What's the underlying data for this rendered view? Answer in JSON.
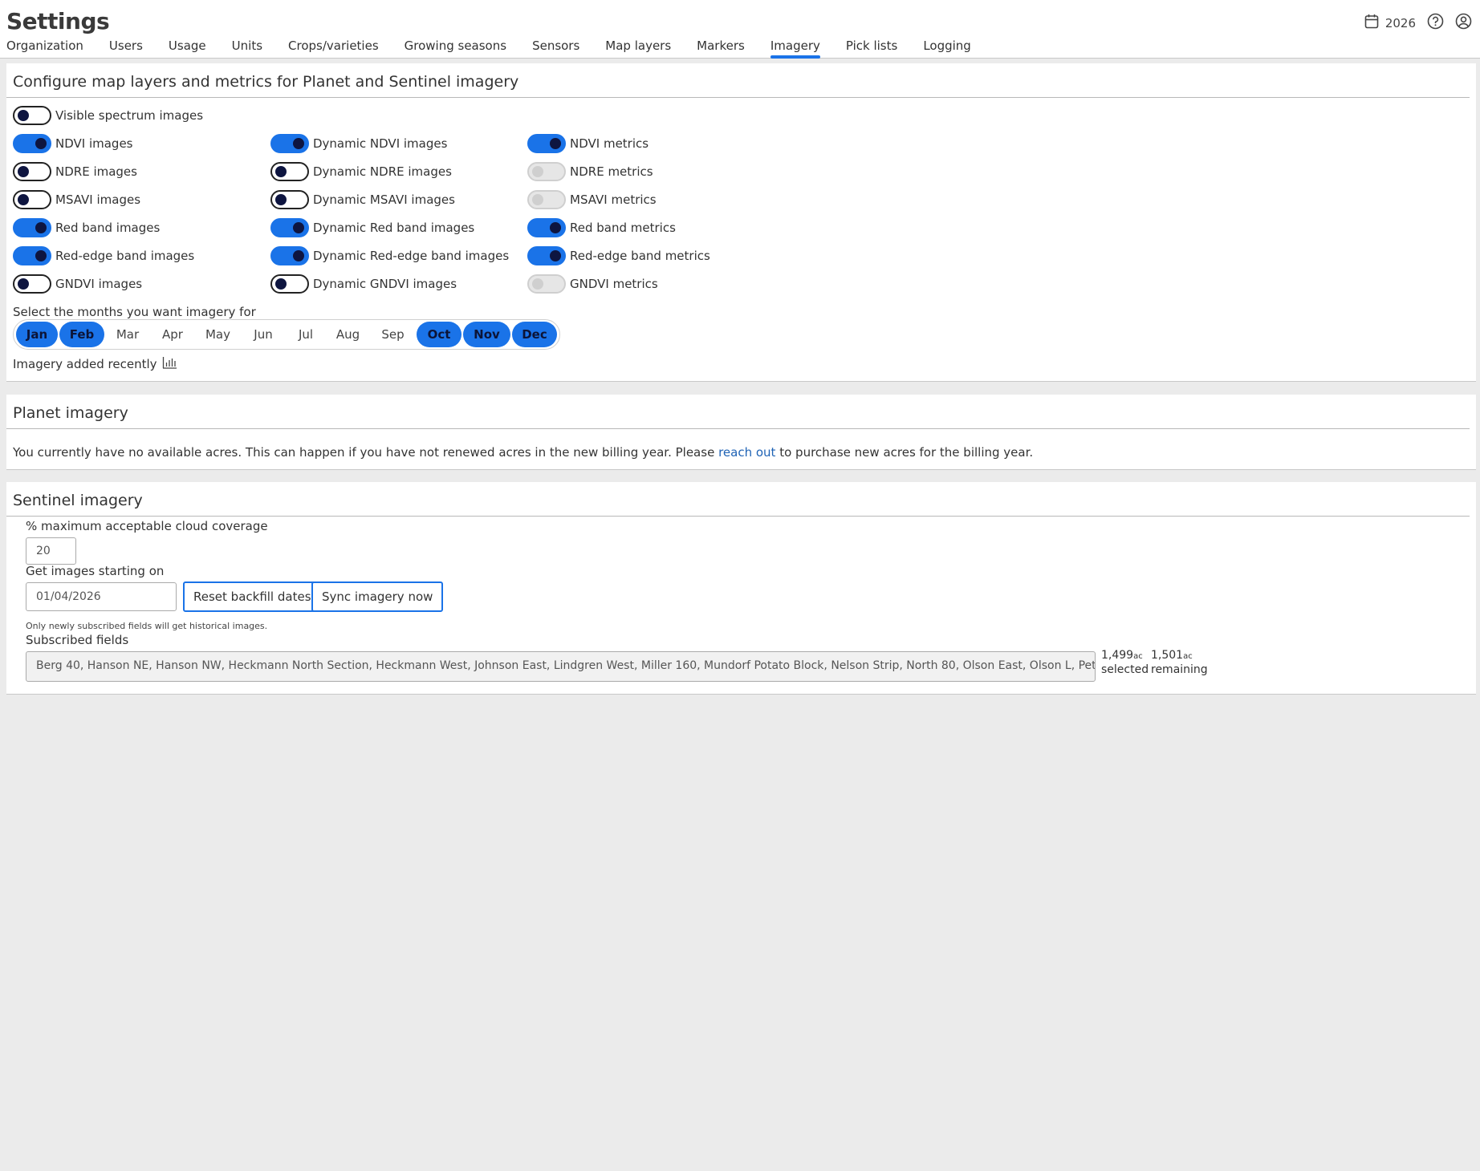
{
  "header": {
    "title": "Settings",
    "year": "2026",
    "tabs": [
      {
        "label": "Organization"
      },
      {
        "label": "Users"
      },
      {
        "label": "Usage"
      },
      {
        "label": "Units"
      },
      {
        "label": "Crops/varieties"
      },
      {
        "label": "Growing seasons"
      },
      {
        "label": "Sensors"
      },
      {
        "label": "Map layers"
      },
      {
        "label": "Markers"
      },
      {
        "label": "Imagery",
        "active": true
      },
      {
        "label": "Pick lists"
      },
      {
        "label": "Logging"
      }
    ]
  },
  "config": {
    "title": "Configure map layers and metrics for Planet and Sentinel imagery",
    "toggles": [
      {
        "label": "Visible spectrum images",
        "state": "off"
      },
      {
        "label": "NDVI images",
        "state": "on"
      },
      {
        "label": "Dynamic NDVI images",
        "state": "on"
      },
      {
        "label": "NDVI metrics",
        "state": "on"
      },
      {
        "label": "NDRE images",
        "state": "off"
      },
      {
        "label": "Dynamic NDRE images",
        "state": "off"
      },
      {
        "label": "NDRE metrics",
        "state": "disabled"
      },
      {
        "label": "MSAVI images",
        "state": "off"
      },
      {
        "label": "Dynamic MSAVI images",
        "state": "off"
      },
      {
        "label": "MSAVI metrics",
        "state": "disabled"
      },
      {
        "label": "Red band images",
        "state": "on"
      },
      {
        "label": "Dynamic Red band images",
        "state": "on"
      },
      {
        "label": "Red band metrics",
        "state": "on"
      },
      {
        "label": "Red-edge band images",
        "state": "on"
      },
      {
        "label": "Dynamic Red-edge band images",
        "state": "on"
      },
      {
        "label": "Red-edge band metrics",
        "state": "on"
      },
      {
        "label": "GNDVI images",
        "state": "off"
      },
      {
        "label": "Dynamic GNDVI images",
        "state": "off"
      },
      {
        "label": "GNDVI metrics",
        "state": "disabled"
      }
    ],
    "months_label": "Select the months you want imagery for",
    "months": [
      {
        "label": "Jan",
        "selected": true
      },
      {
        "label": "Feb",
        "selected": true
      },
      {
        "label": "Mar",
        "selected": false
      },
      {
        "label": "Apr",
        "selected": false
      },
      {
        "label": "May",
        "selected": false
      },
      {
        "label": "Jun",
        "selected": false
      },
      {
        "label": "Jul",
        "selected": false
      },
      {
        "label": "Aug",
        "selected": false
      },
      {
        "label": "Sep",
        "selected": false
      },
      {
        "label": "Oct",
        "selected": true
      },
      {
        "label": "Nov",
        "selected": true
      },
      {
        "label": "Dec",
        "selected": true
      }
    ],
    "recent_label": "Imagery added recently",
    "recent_icon": "bar-chart-icon"
  },
  "planet": {
    "title": "Planet imagery",
    "message_before": "You currently have no available acres. This can happen if you have not renewed acres in the new billing year. Please",
    "link": "reach out",
    "message_after": "to purchase new acres for the billing year."
  },
  "sentinel": {
    "title": "Sentinel imagery",
    "cloud_label": "% maximum acceptable cloud coverage",
    "cloud_value": "20",
    "start_label": "Get images starting on",
    "start_value": "01/04/2026",
    "reset_label": "Reset backfill dates",
    "sync_label": "Sync imagery now",
    "note": "Only newly subscribed fields will get historical images.",
    "fields_label": "Subscribed fields",
    "fields_value": "Berg 40, Hanson NE, Hanson NW, Heckmann North Section, Heckmann West, Johnson East, Lindgren West, Miller 160, Mundorf Potato Block, Nelson Strip, North 80, Olson East, Olson L, Peterson North",
    "selected_acres": "1,499",
    "selected_unit": "ac",
    "selected_label": "selected",
    "remaining_acres": "1,501",
    "remaining_unit": "ac",
    "remaining_label": "remaining"
  },
  "colors": {
    "accent": "#1a73e8",
    "knob": "#0e1540",
    "link": "#1f63b5",
    "background": "#ebebeb"
  }
}
